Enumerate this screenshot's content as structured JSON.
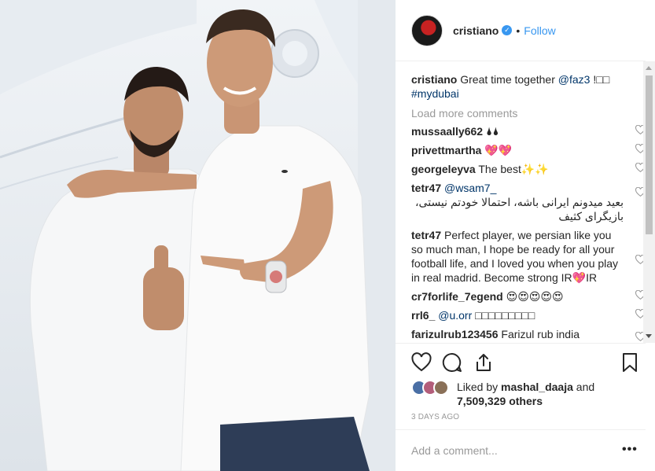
{
  "post": {
    "username": "cristiano",
    "verified_icon": "verified-badge-icon",
    "separator": "•",
    "follow_label": "Follow"
  },
  "caption": {
    "username": "cristiano",
    "text": "Great time together",
    "mention": "@faz3",
    "text_after": "!□□",
    "hashtag": "#mydubai"
  },
  "load_more_label": "Load more comments",
  "comments": [
    {
      "user": "mussaally662",
      "text": "🌢🌢"
    },
    {
      "user": "privettmartha",
      "text": "💖💖"
    },
    {
      "user": "georgeleyva",
      "text": "The best✨✨"
    },
    {
      "user": "tetr47",
      "mention": "@wsam7_",
      "text": "بعید میدونم ایرانی باشه، احتمالا خودتم نیستی، بازیگرای کثیف"
    },
    {
      "user": "tetr47",
      "text": "Perfect player, we persian like you so much man, I hope be ready for all your football life, and I loved you when you play in real madrid. Become strong IR💖IR"
    },
    {
      "user": "cr7forlife_7egend",
      "text": "😍😍😍😍😍"
    },
    {
      "user": "rrl6_",
      "mention": "@u.orr",
      "text": "□□□□□□□□□"
    },
    {
      "user": "farizulrub123456",
      "text": "Farizul rub india"
    }
  ],
  "likes": {
    "prefix": "Liked by",
    "user": "mashal_daaja",
    "connector": "and",
    "count": "7,509,329",
    "suffix": "others"
  },
  "timestamp": "3 DAYS AGO",
  "add_comment_placeholder": "Add a comment...",
  "more_label": "•••",
  "colors": {
    "link": "#3897f0",
    "mention": "#003569",
    "muted": "#999999",
    "text": "#262626"
  }
}
